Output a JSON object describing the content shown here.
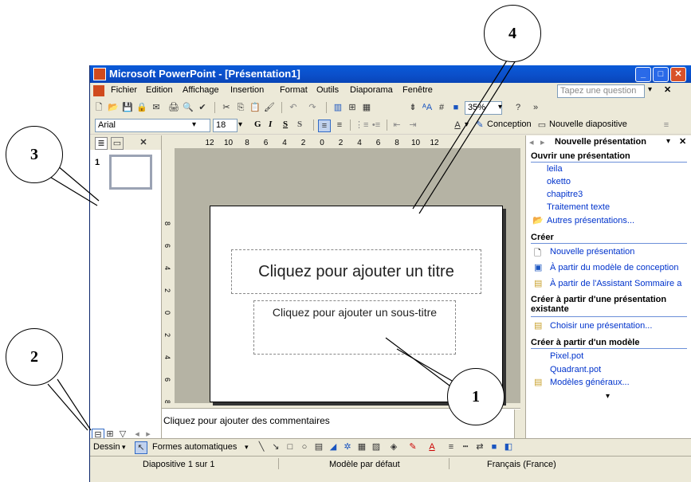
{
  "window": {
    "title": "Microsoft PowerPoint - [Présentation1]"
  },
  "menu": {
    "items": [
      "Fichier",
      "Edition",
      "Affichage",
      "Insertion",
      "Format",
      "Outils",
      "Diaporama",
      "Fenêtre"
    ],
    "help_placeholder": "Tapez une question"
  },
  "toolbar": {
    "zoom": "35%",
    "font": "Arial",
    "size": "18",
    "bold": "G",
    "italic": "I",
    "underline": "S",
    "shadow": "S",
    "design_label": "Conception",
    "new_slide_label": "Nouvelle diapositive"
  },
  "left_panel": {
    "slide_number": "1"
  },
  "ruler": {
    "h_ticks": [
      "12",
      "10",
      "8",
      "6",
      "4",
      "2",
      "0",
      "2",
      "4",
      "6",
      "8",
      "10",
      "12"
    ],
    "v_ticks": [
      "8",
      "6",
      "4",
      "2",
      "0",
      "2",
      "4",
      "6",
      "8"
    ]
  },
  "slide": {
    "title_placeholder": "Cliquez pour ajouter un titre",
    "subtitle_placeholder": "Cliquez pour ajouter un sous-titre"
  },
  "notes": {
    "placeholder": "Cliquez pour ajouter des commentaires"
  },
  "task_pane": {
    "title": "Nouvelle présentation",
    "open_heading": "Ouvrir une présentation",
    "recent_files": [
      "leila",
      "oketto",
      "chapitre3",
      "Traitement texte"
    ],
    "more_presentations": "Autres présentations...",
    "create_heading": "Créer",
    "create_items": [
      "Nouvelle présentation",
      "À partir du modèle de conception",
      "À partir de l'Assistant Sommaire a"
    ],
    "from_existing_heading": "Créer à partir d'une présentation existante",
    "choose_presentation": "Choisir une présentation...",
    "from_template_heading": "Créer à partir d'un modèle",
    "templates": [
      "Pixel.pot",
      "Quadrant.pot"
    ],
    "general_templates": "Modèles généraux..."
  },
  "drawing_toolbar": {
    "draw": "Dessin",
    "autoshapes": "Formes automatiques"
  },
  "status_bar": {
    "slide": "Diapositive 1 sur 1",
    "design": "Modèle par défaut",
    "language": "Français (France)"
  },
  "callouts": [
    "1",
    "2",
    "3",
    "4"
  ],
  "colors": {
    "titlebar": "#0a5bd8",
    "link": "#0033cc",
    "chrome": "#ece9d8"
  }
}
